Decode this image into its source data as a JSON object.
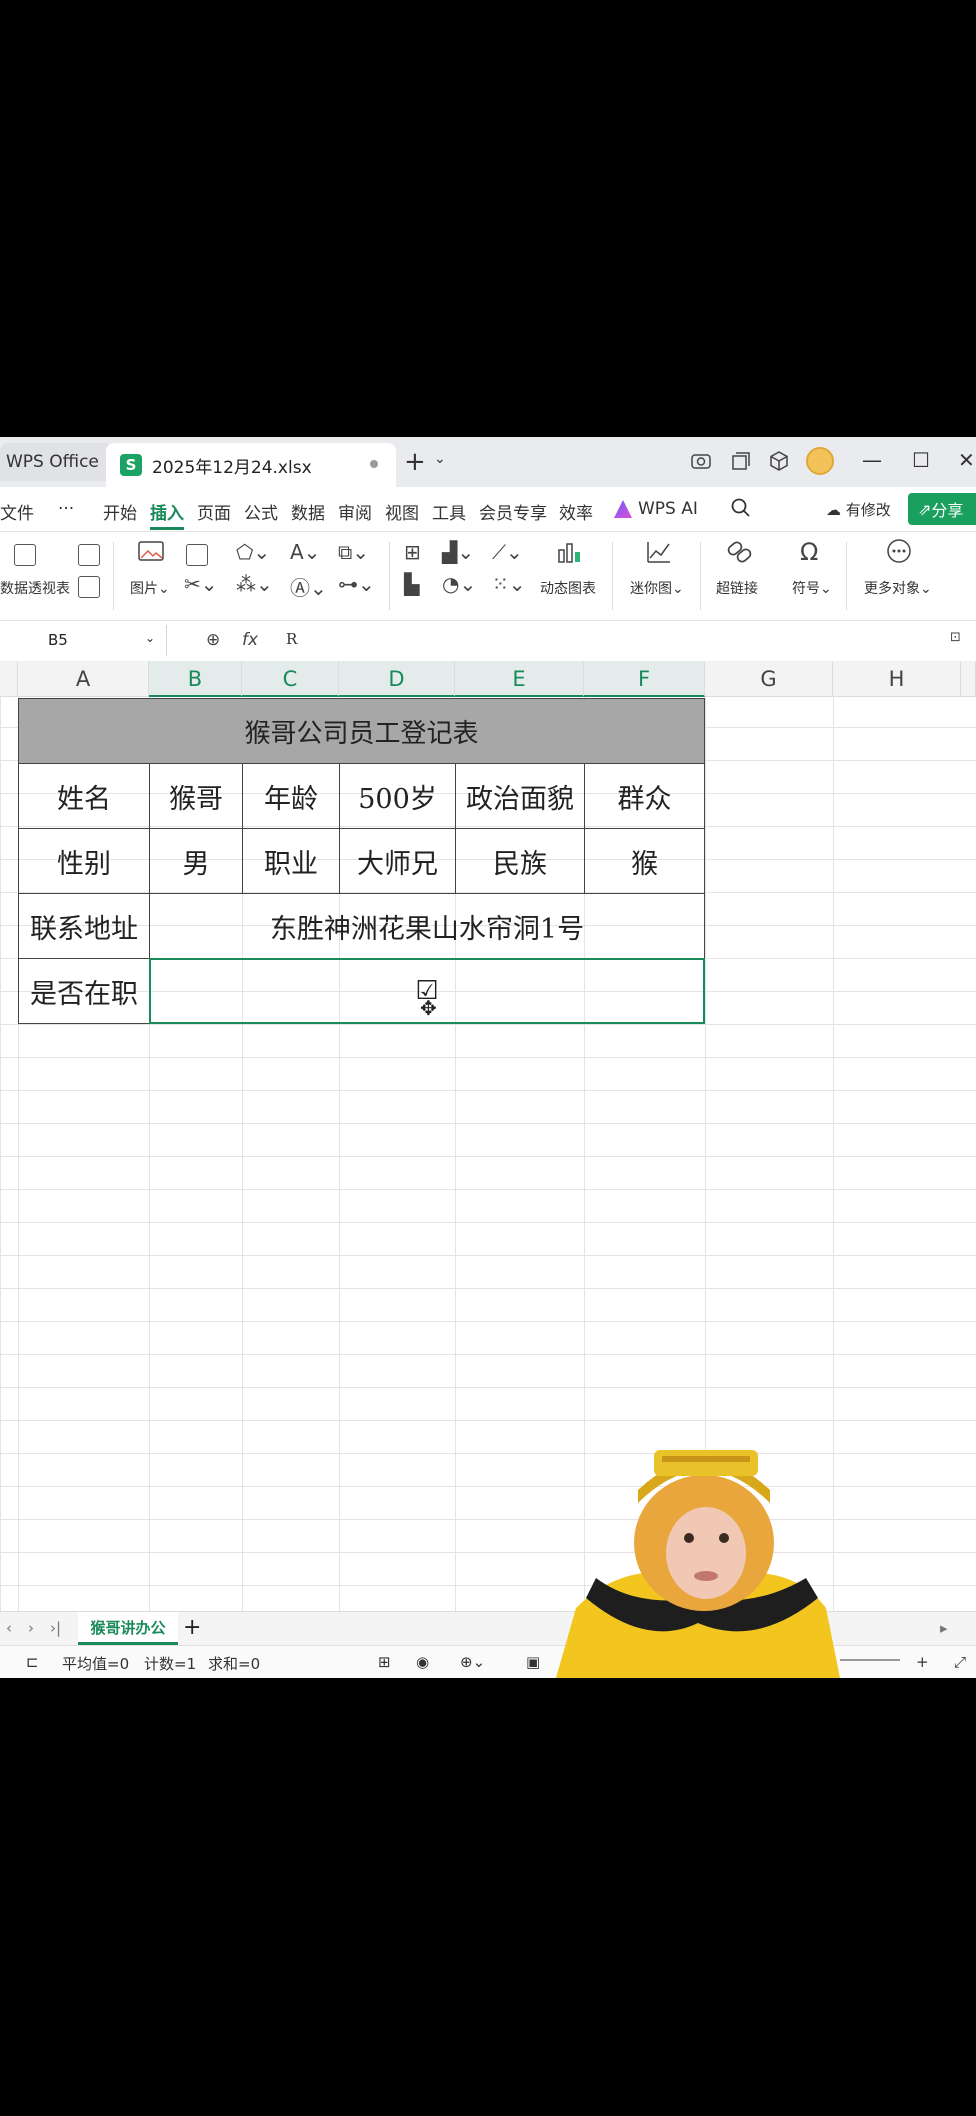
{
  "titlebar": {
    "home_tab": "WPS Office",
    "file_tab": "2025年12月24.xlsx",
    "file_icon_letter": "S",
    "new_tab": "+",
    "tab_menu": "⌄"
  },
  "menubar": {
    "items": [
      "文件",
      "···",
      "开始",
      "插入",
      "页面",
      "公式",
      "数据",
      "审阅",
      "视图",
      "工具",
      "会员专享",
      "效率"
    ],
    "active": "插入",
    "ai": "WPS AI",
    "modified": "有修改",
    "share": "分享"
  },
  "ribbon": {
    "pivot": "数据透视表",
    "picture": "图片",
    "dynamic_chart": "动态图表",
    "sparkline": "迷你图",
    "hyperlink": "超链接",
    "symbol": "符号",
    "more": "更多对象"
  },
  "formula_bar": {
    "name_box": "B5",
    "fx": "fx",
    "value": "R"
  },
  "columns": [
    "A",
    "B",
    "C",
    "D",
    "E",
    "F",
    "G",
    "H"
  ],
  "sheet_table": {
    "title": "猴哥公司员工登记表",
    "row1": [
      "姓名",
      "猴哥",
      "年龄",
      "500岁",
      "政治面貌",
      "群众"
    ],
    "row2": [
      "性别",
      "男",
      "职业",
      "大师兄",
      "民族",
      "猴"
    ],
    "row3_label": "联系地址",
    "row3_value": "东胜神洲花果山水帘洞1号",
    "row4_label": "是否在职",
    "row4_value": "☑"
  },
  "sheets": {
    "active": "猴哥讲办公",
    "add": "+"
  },
  "status": {
    "average": "平均值=0",
    "count": "计数=1",
    "sum": "求和=0"
  }
}
